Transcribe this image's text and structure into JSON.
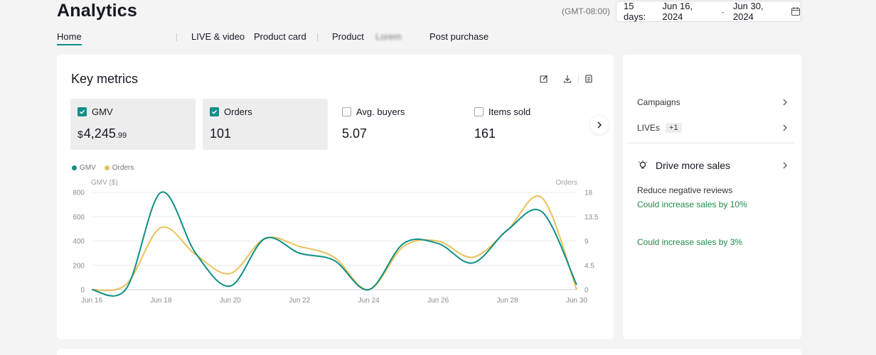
{
  "page": {
    "title": "Analytics"
  },
  "date": {
    "timezone": "(GMT-08:00)",
    "range_label": "15 days:",
    "start": "Jun 16, 2024",
    "separator": "-",
    "end": "Jun 30, 2024"
  },
  "tabs": [
    {
      "label": "Home",
      "active": true
    },
    {
      "label": "LIVE & video"
    },
    {
      "label": "Product card"
    },
    {
      "label": "Product"
    },
    {
      "label": "Lorem"
    },
    {
      "label": "Post purchase"
    }
  ],
  "key_metrics": {
    "title": "Key metrics",
    "tools": [
      "edit-icon",
      "download-icon",
      "report-icon"
    ],
    "metrics": [
      {
        "label": "GMV",
        "checked": true,
        "currency": "$",
        "value": "4,245",
        "cents": ".99"
      },
      {
        "label": "Orders",
        "checked": true,
        "value": "101"
      },
      {
        "label": "Avg. buyers",
        "checked": false,
        "value": "5.07"
      },
      {
        "label": "Items sold",
        "checked": false,
        "value": "161"
      }
    ]
  },
  "colors": {
    "gmv": "#0f8f86",
    "orders": "#e8c15a",
    "accent": "#0f8f86",
    "green_text": "#1f8a4c"
  },
  "chart_data": {
    "type": "line",
    "legend": [
      "GMV",
      "Orders"
    ],
    "y_left_label": "GMV ($)",
    "y_right_label": "Orders",
    "y_left_ticks": [
      "800",
      "600",
      "400",
      "200",
      "0"
    ],
    "y_right_ticks": [
      "18",
      "13.5",
      "9",
      "4.5",
      "0"
    ],
    "x_ticks": [
      "Jun 16",
      "Jun 18",
      "Jun 20",
      "Jun 22",
      "Jun 24",
      "Jun 26",
      "Jun 28",
      "Jun 30"
    ],
    "ylim_left": [
      0,
      800
    ],
    "ylim_right": [
      0,
      18
    ],
    "x": [
      "Jun 16",
      "Jun 17",
      "Jun 18",
      "Jun 19",
      "Jun 20",
      "Jun 21",
      "Jun 22",
      "Jun 23",
      "Jun 24",
      "Jun 25",
      "Jun 26",
      "Jun 27",
      "Jun 28",
      "Jun 29",
      "Jun 30"
    ],
    "series": [
      {
        "name": "GMV",
        "axis": "left",
        "values": [
          0,
          10,
          800,
          300,
          30,
          420,
          300,
          240,
          0,
          380,
          380,
          220,
          490,
          640,
          40
        ]
      },
      {
        "name": "Orders",
        "axis": "right",
        "values": [
          0,
          1,
          11.5,
          6.5,
          3,
          9.5,
          8,
          6,
          0,
          8,
          9,
          6,
          11,
          17,
          0
        ]
      }
    ]
  },
  "sidebar": {
    "campaigns": "Campaigns",
    "lives": "LIVEs",
    "lives_badge": "+1",
    "drive_title": "Drive more sales",
    "suggestion_title": "Reduce negative reviews",
    "suggestion_1": "Could increase sales by 10%",
    "suggestion_2": "Could increase sales by 3%"
  }
}
